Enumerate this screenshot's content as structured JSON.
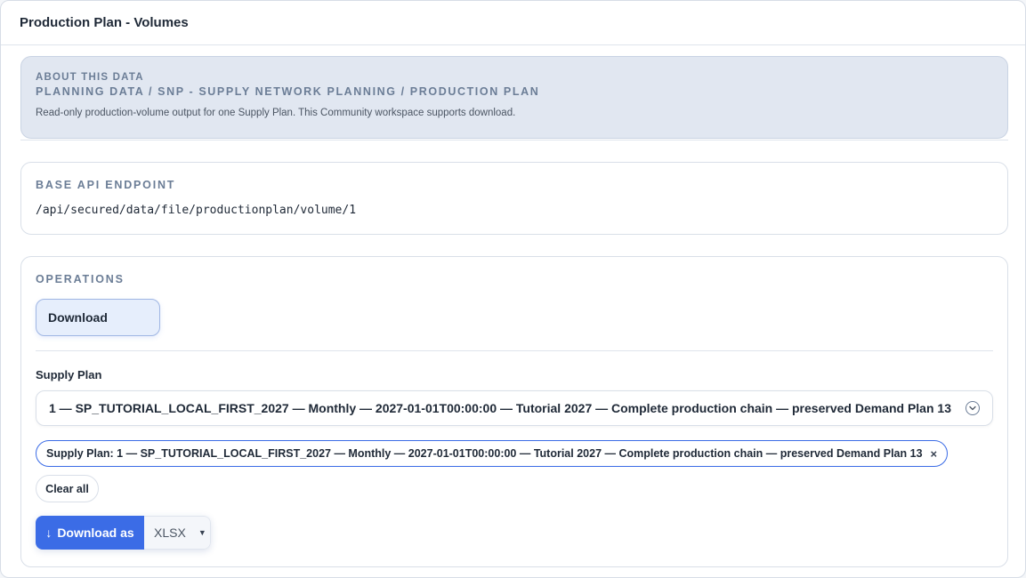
{
  "window": {
    "title": "Production Plan - Volumes"
  },
  "about": {
    "kicker": "ABOUT THIS DATA",
    "path": "PLANNING DATA / SNP - SUPPLY NETWORK PLANNING / PRODUCTION PLAN",
    "description": "Read-only production-volume output for one Supply Plan. This Community workspace supports download."
  },
  "endpoint": {
    "label": "BASE API ENDPOINT",
    "value": "/api/secured/data/file/productionplan/volume/1"
  },
  "operations": {
    "label": "OPERATIONS",
    "active_operation": "Download",
    "supply_plan_label": "Supply Plan",
    "supply_plan_value": "1 — SP_TUTORIAL_LOCAL_FIRST_2027 — Monthly — 2027-01-01T00:00:00 — Tutorial 2027 — Complete production chain — preserved Demand Plan 13",
    "chip_text": "Supply Plan: 1 — SP_TUTORIAL_LOCAL_FIRST_2027 — Monthly — 2027-01-01T00:00:00 — Tutorial 2027 — Complete production chain — preserved Demand Plan 13",
    "chip_close": "×",
    "clear_all": "Clear all",
    "download_icon": "↓",
    "download_label": "Download as",
    "format": "XLSX",
    "format_caret": "▼"
  },
  "colors": {
    "accent": "#3b6ce6",
    "about_bg": "#e1e7f1",
    "label_muted": "#6b7d96"
  },
  "icons": {
    "chevron": "chevron-down-icon",
    "download": "download-arrow-icon",
    "close": "close-icon",
    "caret": "caret-down-icon"
  }
}
